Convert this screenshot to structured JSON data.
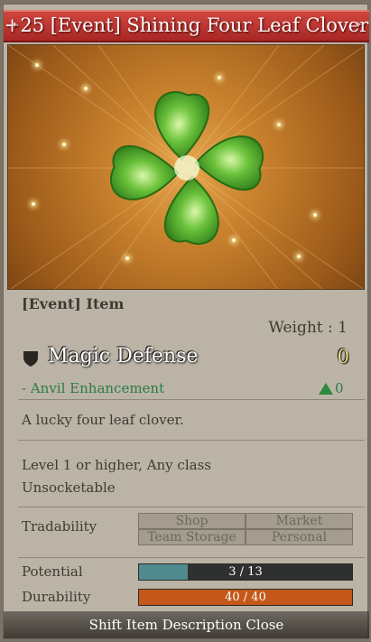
{
  "item_title": "+25 [Event] Shining Four Leaf Clover",
  "item_type": "[Event] Item",
  "weight": "Weight : 1",
  "stat": {
    "name": "Magic Defense",
    "value": "0"
  },
  "enhancement": {
    "label": "- Anvil Enhancement",
    "value": "0"
  },
  "description": "A lucky four leaf clover.",
  "requirement": "Level 1 or higher, Any class",
  "socket": "Unsocketable",
  "tradability": {
    "label": "Tradability",
    "cells": [
      "Shop",
      "Market",
      "Team Storage",
      "Personal"
    ]
  },
  "potential": {
    "label": "Potential",
    "text": "3 / 13",
    "fraction": 0.23
  },
  "durability": {
    "label": "Durability",
    "text": "40 / 40",
    "fraction": 1.0
  },
  "footer": "Shift Item Description Close",
  "colors": {
    "title_bg": "#b9302c",
    "enhancement_green": "#2b7a48",
    "potential_fill": "#4f8a8f",
    "durability_fill": "#c4581a"
  }
}
